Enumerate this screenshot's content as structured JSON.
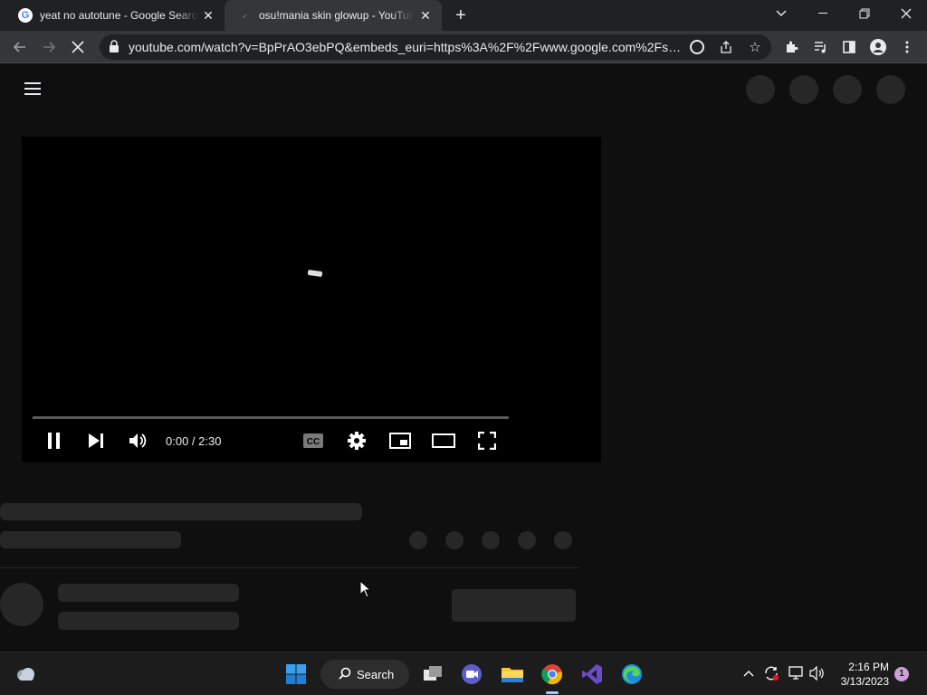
{
  "browser": {
    "tabs": [
      {
        "title": "yeat no autotune - Google Search",
        "favicon": "google-g-icon"
      },
      {
        "title": "osu!mania skin glowup - YouTube",
        "favicon": "loading-icon"
      }
    ],
    "url": "youtube.com/watch?v=BpPrAO3ebPQ&embeds_euri=https%3A%2F%2Fwww.google.com%2Fsea..."
  },
  "player": {
    "time": "0:00 / 2:30",
    "progress": 0
  },
  "taskbar": {
    "search_label": "Search",
    "clock_time": "2:16 PM",
    "clock_date": "3/13/2023",
    "notification_count": "1"
  },
  "colors": {
    "page_bg": "#0f0f0f",
    "skeleton": "#272727",
    "chrome_toolbar": "#35363a",
    "chrome_tabstrip": "#202124",
    "taskbar": "#1c1c1c"
  }
}
